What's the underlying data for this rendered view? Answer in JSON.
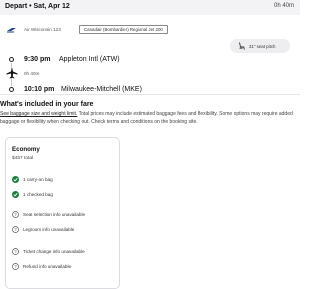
{
  "header": {
    "route": "Depart • Sat, Apr 12",
    "duration": "0h 40m"
  },
  "flight": {
    "airline": "Air Wisconsin 123",
    "aircraft": "Canadair (Bombardier) Regional Jet 200",
    "seat_pitch": "31\" seat pitch",
    "departure_time": "9:30 pm",
    "departure_airport": "Appleton Intl (ATW)",
    "leg_duration": "0h 40m",
    "arrival_time": "10:10 pm",
    "arrival_airport": "Milwaukee-Mitchell (MKE)"
  },
  "fare_section": {
    "title": "What's included in your fare",
    "link_text": "See baggage size and weight limit.",
    "body": " Total prices may include estimated baggage fees and flexibility. Some options may require added baggage or flexibility when checking out. Check terms and conditions on the booking site."
  },
  "fare_card": {
    "name": "Economy",
    "price": "$457 total",
    "features": [
      {
        "label": "1 carry-on bag",
        "icon": "check-circle-icon"
      },
      {
        "label": "1 checked bag",
        "icon": "check-circle-icon"
      },
      {
        "label": "Seat selection info unavailable",
        "icon": "question-circle-icon"
      },
      {
        "label": "Legroom info unavailable",
        "icon": "question-circle-icon"
      },
      {
        "label": "Ticket change info unavailable",
        "icon": "question-circle-icon"
      },
      {
        "label": "Refund info unavailable",
        "icon": "question-circle-icon"
      }
    ]
  },
  "colors": {
    "check_green": "#1a7f3c",
    "header_bg": "#f3f3f5"
  }
}
